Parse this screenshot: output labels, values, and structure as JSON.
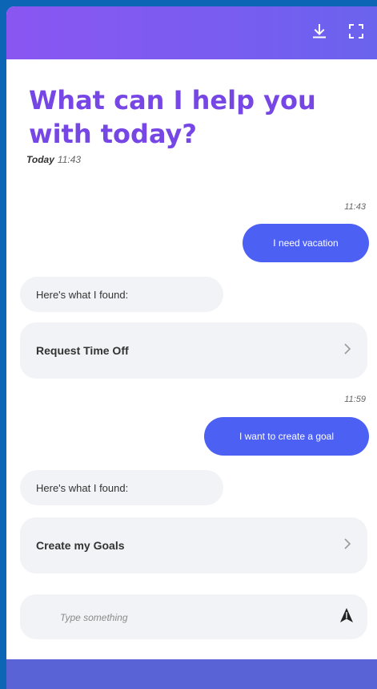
{
  "header": {
    "download_icon": "download-icon",
    "fullscreen_icon": "fullscreen-icon"
  },
  "welcome": {
    "title": "What can I help you with today?",
    "day_label": "Today",
    "time": "11:43"
  },
  "messages": [
    {
      "from": "user",
      "time": "11:43",
      "text": "I need vacation"
    },
    {
      "from": "bot",
      "text": "Here's what I found:",
      "card_label": "Request Time Off"
    },
    {
      "from": "user",
      "time": "11:59",
      "text": "I want to create a goal"
    },
    {
      "from": "bot",
      "text": "Here's what I found:",
      "card_label": "Create my Goals"
    }
  ],
  "composer": {
    "placeholder": "Type something",
    "send_icon": "send-icon"
  },
  "colors": {
    "accent": "#7747e6",
    "user_bubble": "#4c60f3",
    "footer": "#5a63d6"
  }
}
